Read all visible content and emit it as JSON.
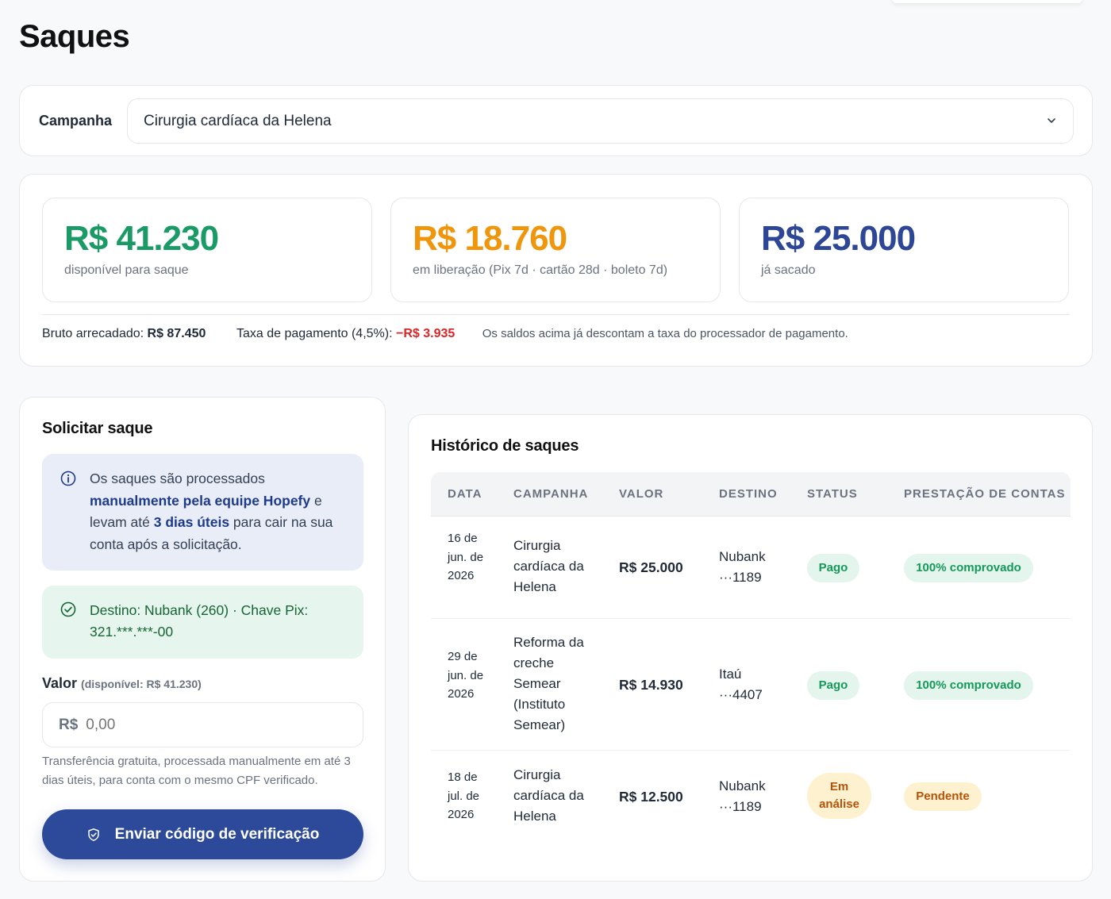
{
  "page": {
    "title": "Saques"
  },
  "campaign": {
    "label": "Campanha",
    "selected": "Cirurgia cardíaca da Helena"
  },
  "balances": {
    "available": {
      "amount": "R$ 41.230",
      "label": "disponível para saque",
      "color": "#1a9a66"
    },
    "pending": {
      "amount": "R$ 18.760",
      "label": "em liberação (Pix 7d · cartão 28d · boleto 7d)",
      "color": "#f0960c"
    },
    "withdrawn": {
      "amount": "R$ 25.000",
      "label": "já sacado",
      "color": "#2d4796"
    }
  },
  "summary": {
    "gross_label": "Bruto arrecadado:",
    "gross_value": "R$ 87.450",
    "fee_label": "Taxa de pagamento (4,5%):",
    "fee_value": "−R$ 3.935",
    "note": "Os saldos acima já descontam a taxa do processador de pagamento."
  },
  "request": {
    "title": "Solicitar saque",
    "info_part1": "Os saques são processados ",
    "info_bold1": "manualmente pela equipe Hopefy",
    "info_part2": " e levam até ",
    "info_bold2": "3 dias úteis",
    "info_part3": " para cair na sua conta após a solicitação.",
    "destination": "Destino: Nubank (260) · Chave Pix: 321.***.***-00",
    "value_label": "Valor",
    "value_available": "(disponível: R$ 41.230)",
    "currency": "R$",
    "value_placeholder": "0,00",
    "helper": "Transferência gratuita, processada manualmente em até 3 dias úteis, para conta com o mesmo CPF verificado.",
    "submit_label": "Enviar código de verificação"
  },
  "history": {
    "title": "Histórico de saques",
    "columns": [
      "DATA",
      "CAMPANHA",
      "VALOR",
      "DESTINO",
      "STATUS",
      "PRESTAÇÃO DE CONTAS"
    ],
    "rows": [
      {
        "date": "16 de jun. de 2026",
        "campaign": "Cirurgia cardíaca da Helena",
        "amount": "R$ 25.000",
        "destination": "Nubank ···1189",
        "status": "Pago",
        "accountability": "100% comprovado"
      },
      {
        "date": "29 de jun. de 2026",
        "campaign": "Reforma da creche Semear (Instituto Semear)",
        "amount": "R$ 14.930",
        "destination": "Itaú ···4407",
        "status": "Pago",
        "accountability": "100% comprovado"
      },
      {
        "date": "18 de jul. de 2026",
        "campaign": "Cirurgia cardíaca da Helena",
        "amount": "R$ 12.500",
        "destination": "Nubank ···1189",
        "status": "Em análise",
        "accountability": "Pendente"
      }
    ]
  }
}
